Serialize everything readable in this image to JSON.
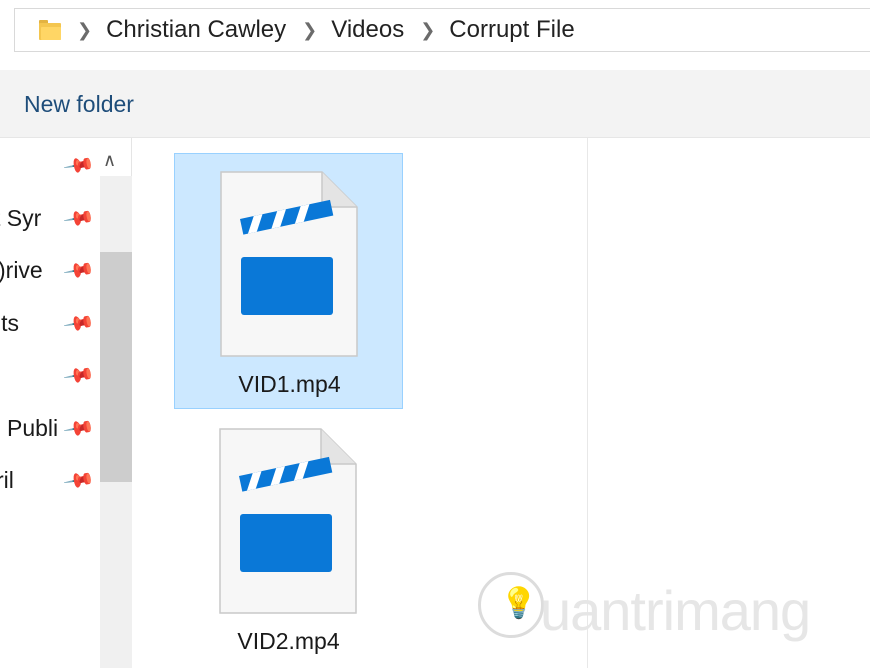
{
  "address": {
    "breadcrumbs": [
      "Christian Cawley",
      "Videos",
      "Corrupt File"
    ]
  },
  "toolbar": {
    "new_folder_label": "New folder"
  },
  "nav": {
    "items": [
      {
        "label": ""
      },
      {
        "label": "t Syr"
      },
      {
        "label": ")rive"
      },
      {
        "label": "its"
      },
      {
        "label": ""
      },
      {
        "label": "Publi"
      },
      {
        "label": "ril"
      }
    ]
  },
  "files": [
    {
      "name": "VID1.mp4",
      "selected": true
    },
    {
      "name": "VID2.mp4",
      "selected": false
    }
  ],
  "watermark": {
    "text": "uantrimang"
  },
  "colors": {
    "selection_bg": "#cce8ff",
    "selection_border": "#99d1ff",
    "video_blue": "#0a78d7",
    "link_blue": "#1e4d7a"
  }
}
